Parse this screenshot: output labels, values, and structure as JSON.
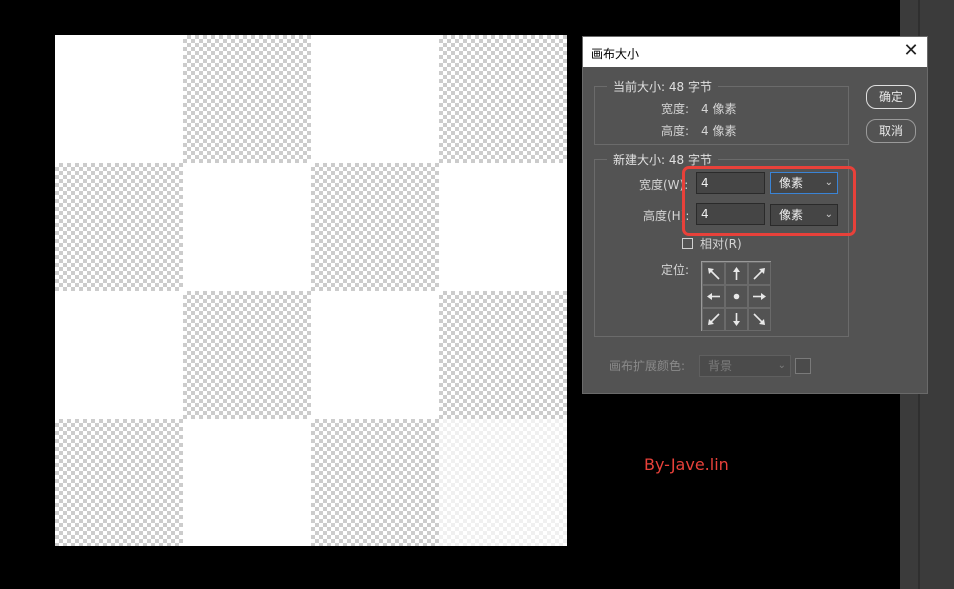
{
  "dialog": {
    "title": "画布大小",
    "ok_label": "确定",
    "cancel_label": "取消",
    "current_size": {
      "label": "当前大小: 48 字节",
      "width_label": "宽度:",
      "width_value": "4 像素",
      "height_label": "高度:",
      "height_value": "4 像素"
    },
    "new_size": {
      "label": "新建大小: 48 字节",
      "width_label": "宽度(W):",
      "width_value": "4",
      "width_unit": "像素",
      "height_label": "高度(H):",
      "height_value": "4",
      "height_unit": "像素",
      "relative_label": "相对(R)",
      "relative_checked": false,
      "anchor_label": "定位:"
    },
    "extension_color": {
      "label": "画布扩展颜色:",
      "value": "背景"
    }
  },
  "watermark": "By-Jave.lin",
  "colors": {
    "highlight": "#e8413a",
    "dialog_bg": "#535353",
    "focus_border": "#3a84d6"
  },
  "icons": {
    "close": "close-icon",
    "dropdown": "chevron-down-icon",
    "anchor_arrows": [
      "arrow-up-left-icon",
      "arrow-up-icon",
      "arrow-up-right-icon",
      "arrow-left-icon",
      "anchor-center-dot-icon",
      "arrow-right-icon",
      "arrow-down-left-icon",
      "arrow-down-icon",
      "arrow-down-right-icon"
    ]
  }
}
